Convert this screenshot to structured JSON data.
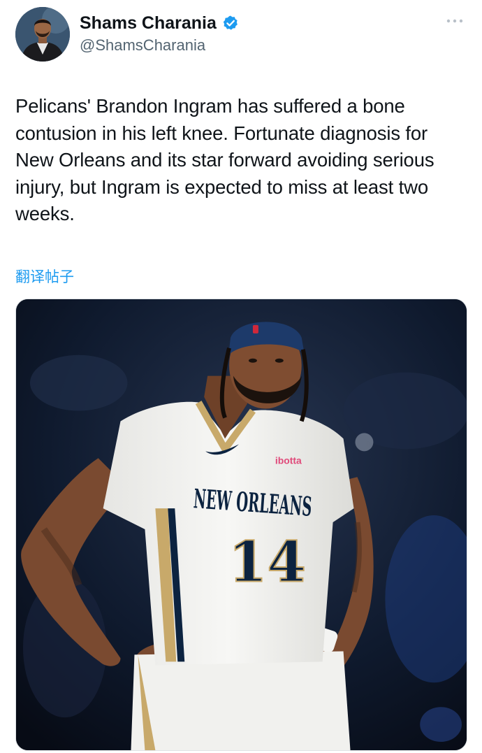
{
  "tweet": {
    "author": {
      "display_name": "Shams Charania",
      "handle": "@ShamsCharania",
      "verified": true,
      "verified_color": "#1d9bf0"
    },
    "text": "Pelicans' Brandon Ingram has suffered a bone contusion in his left knee. Fortunate diagnosis for New Orleans and its star forward avoiding serious injury, but Ingram is expected to miss at least two weeks.",
    "translate_label": "翻译帖子",
    "media": {
      "jersey_text": "NEW ORLEANS",
      "jersey_number": "14",
      "sponsor": "ibotta"
    }
  },
  "colors": {
    "text": "#0f1419",
    "secondary": "#536471",
    "link": "#1d9bf0",
    "jersey": "#f4f4f2",
    "navy": "#0c2340",
    "gold": "#c8a96a"
  },
  "icons": [
    "avatar",
    "verified-badge-icon",
    "more-options-icon"
  ]
}
